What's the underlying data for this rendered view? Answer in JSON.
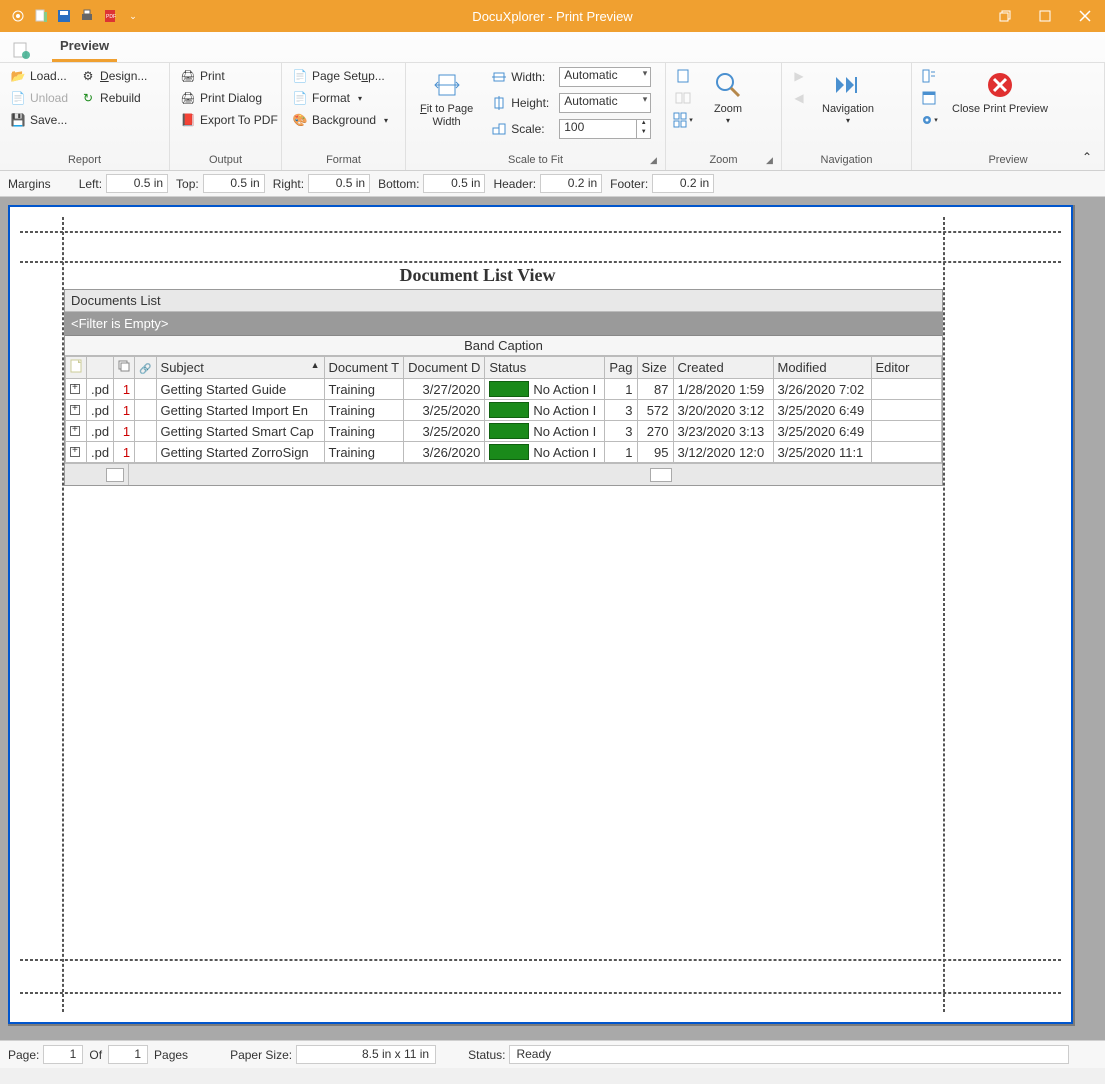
{
  "window": {
    "title": "DocuXplorer - Print Preview"
  },
  "ribbon": {
    "tab": "Preview",
    "report": {
      "label": "Report",
      "load": "Load...",
      "unload": "Unload",
      "save": "Save...",
      "design": "Design...",
      "rebuild": "Rebuild"
    },
    "output": {
      "label": "Output",
      "print": "Print",
      "printdialog": "Print Dialog",
      "exportpdf": "Export To PDF"
    },
    "format": {
      "label": "Format",
      "pagesetup": "Page Setup...",
      "format": "Format",
      "background": "Background"
    },
    "scaletofit": {
      "label": "Scale to Fit",
      "fitpagewidth": "Fit to Page Width",
      "width_label": "Width:",
      "width_value": "Automatic",
      "height_label": "Height:",
      "height_value": "Automatic",
      "scale_label": "Scale:",
      "scale_value": "100"
    },
    "zoom": {
      "label": "Zoom",
      "zoom": "Zoom"
    },
    "navigation": {
      "label": "Navigation",
      "navigation": "Navigation"
    },
    "preview": {
      "label": "Preview",
      "close": "Close Print Preview"
    }
  },
  "margins": {
    "label": "Margins",
    "left_label": "Left:",
    "left_value": "0.5 in",
    "top_label": "Top:",
    "top_value": "0.5 in",
    "right_label": "Right:",
    "right_value": "0.5 in",
    "bottom_label": "Bottom:",
    "bottom_value": "0.5 in",
    "header_label": "Header:",
    "header_value": "0.2 in",
    "footer_label": "Footer:",
    "footer_value": "0.2 in"
  },
  "document": {
    "title": "Document List View",
    "section_label": "Documents List",
    "filter_text": "<Filter is Empty>",
    "band_caption": "Band Caption",
    "columns": [
      "",
      "",
      "",
      "",
      "Subject",
      "Document T",
      "Document D",
      "Status",
      "Pag",
      "Size",
      "Created",
      "Modified",
      "Editor"
    ],
    "rows": [
      {
        "ext": ".pd",
        "idx": "1",
        "subject": "Getting Started Guide",
        "doctype": "Training",
        "docdate": "3/27/2020",
        "status": "No Action I",
        "pages": "1",
        "size": "87",
        "created": "1/28/2020 1:59",
        "modified": "3/26/2020 7:02",
        "editor": ""
      },
      {
        "ext": ".pd",
        "idx": "1",
        "subject": "Getting Started Import En",
        "doctype": "Training",
        "docdate": "3/25/2020",
        "status": "No Action I",
        "pages": "3",
        "size": "572",
        "created": "3/20/2020 3:12",
        "modified": "3/25/2020 6:49",
        "editor": ""
      },
      {
        "ext": ".pd",
        "idx": "1",
        "subject": "Getting Started Smart Cap",
        "doctype": "Training",
        "docdate": "3/25/2020",
        "status": "No Action I",
        "pages": "3",
        "size": "270",
        "created": "3/23/2020 3:13",
        "modified": "3/25/2020 6:49",
        "editor": ""
      },
      {
        "ext": ".pd",
        "idx": "1",
        "subject": "Getting Started ZorroSign",
        "doctype": "Training",
        "docdate": "3/26/2020",
        "status": "No Action I",
        "pages": "1",
        "size": "95",
        "created": "3/12/2020 12:0",
        "modified": "3/25/2020 11:1",
        "editor": ""
      }
    ]
  },
  "statusbar": {
    "page_label": "Page:",
    "page_value": "1",
    "of_label": "Of",
    "of_value": "1",
    "pages_label": "Pages",
    "papersize_label": "Paper Size:",
    "papersize_value": "8.5 in x 11 in",
    "status_label": "Status:",
    "status_value": "Ready"
  }
}
